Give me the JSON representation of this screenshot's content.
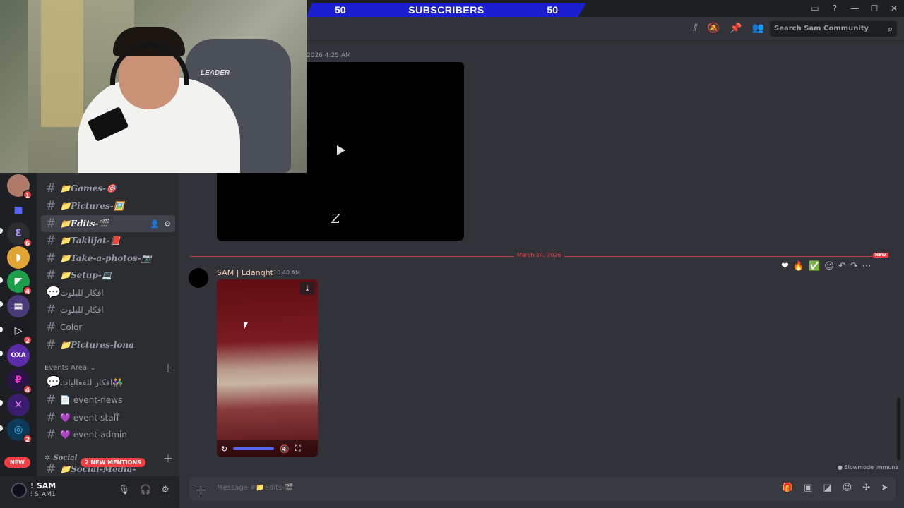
{
  "stream_overlay": {
    "sub_left": "50",
    "sub_label": "SUBSCRIBERS",
    "sub_right": "50",
    "chair_brand": "LEADER"
  },
  "header": {
    "search_placeholder": "Search Sam Community"
  },
  "servers": [
    {
      "badge": "1"
    },
    {
      "badge": ""
    },
    {
      "badge": "6"
    },
    {
      "badge": ""
    },
    {
      "badge": "4"
    },
    {
      "badge": ""
    },
    {
      "badge": "2"
    },
    {
      "badge": ""
    },
    {
      "badge": "4"
    },
    {
      "badge": ""
    },
    {
      "badge": "2"
    }
  ],
  "channels": [
    {
      "name": "📁Games-🎯"
    },
    {
      "name": "📁Pictures-🖼️"
    },
    {
      "name": "📁Edits-🎬"
    },
    {
      "name": "📁Taklijat-📕"
    },
    {
      "name": "📁Take-a-photos-📷"
    },
    {
      "name": "📁Setup-💻"
    },
    {
      "name": "افكار للبلوت"
    },
    {
      "name": "افكار للبلوت"
    },
    {
      "name": "Color"
    },
    {
      "name": "📁Pictures-lona"
    }
  ],
  "events_category": "Events Area",
  "event_channels": [
    {
      "name": "افكار للفعاليات👫"
    },
    {
      "name": "📄 event-news"
    },
    {
      "name": "💜 event-staff"
    },
    {
      "name": "💜 event-admin"
    }
  ],
  "social_category": "Social",
  "social_channel": "📁Social-Media-",
  "mentions_pill": "2 NEW MENTIONS",
  "new_pill": "NEW",
  "user": {
    "name": "! SAM",
    "tag": ": S_AM1"
  },
  "chat": {
    "prev_timestamp": "2026 4:25 AM",
    "divider_date": "March 24, 2026",
    "new_tag": "NEW",
    "message": {
      "author": "SAM | Ldanqht",
      "time": "10:40 AM"
    },
    "video_signature": "Z",
    "slowmode": "Slowmode Immune",
    "composer_placeholder": "Message #📁Edits-🎬"
  },
  "reactions": [
    "❤",
    "🔥",
    "✅"
  ]
}
